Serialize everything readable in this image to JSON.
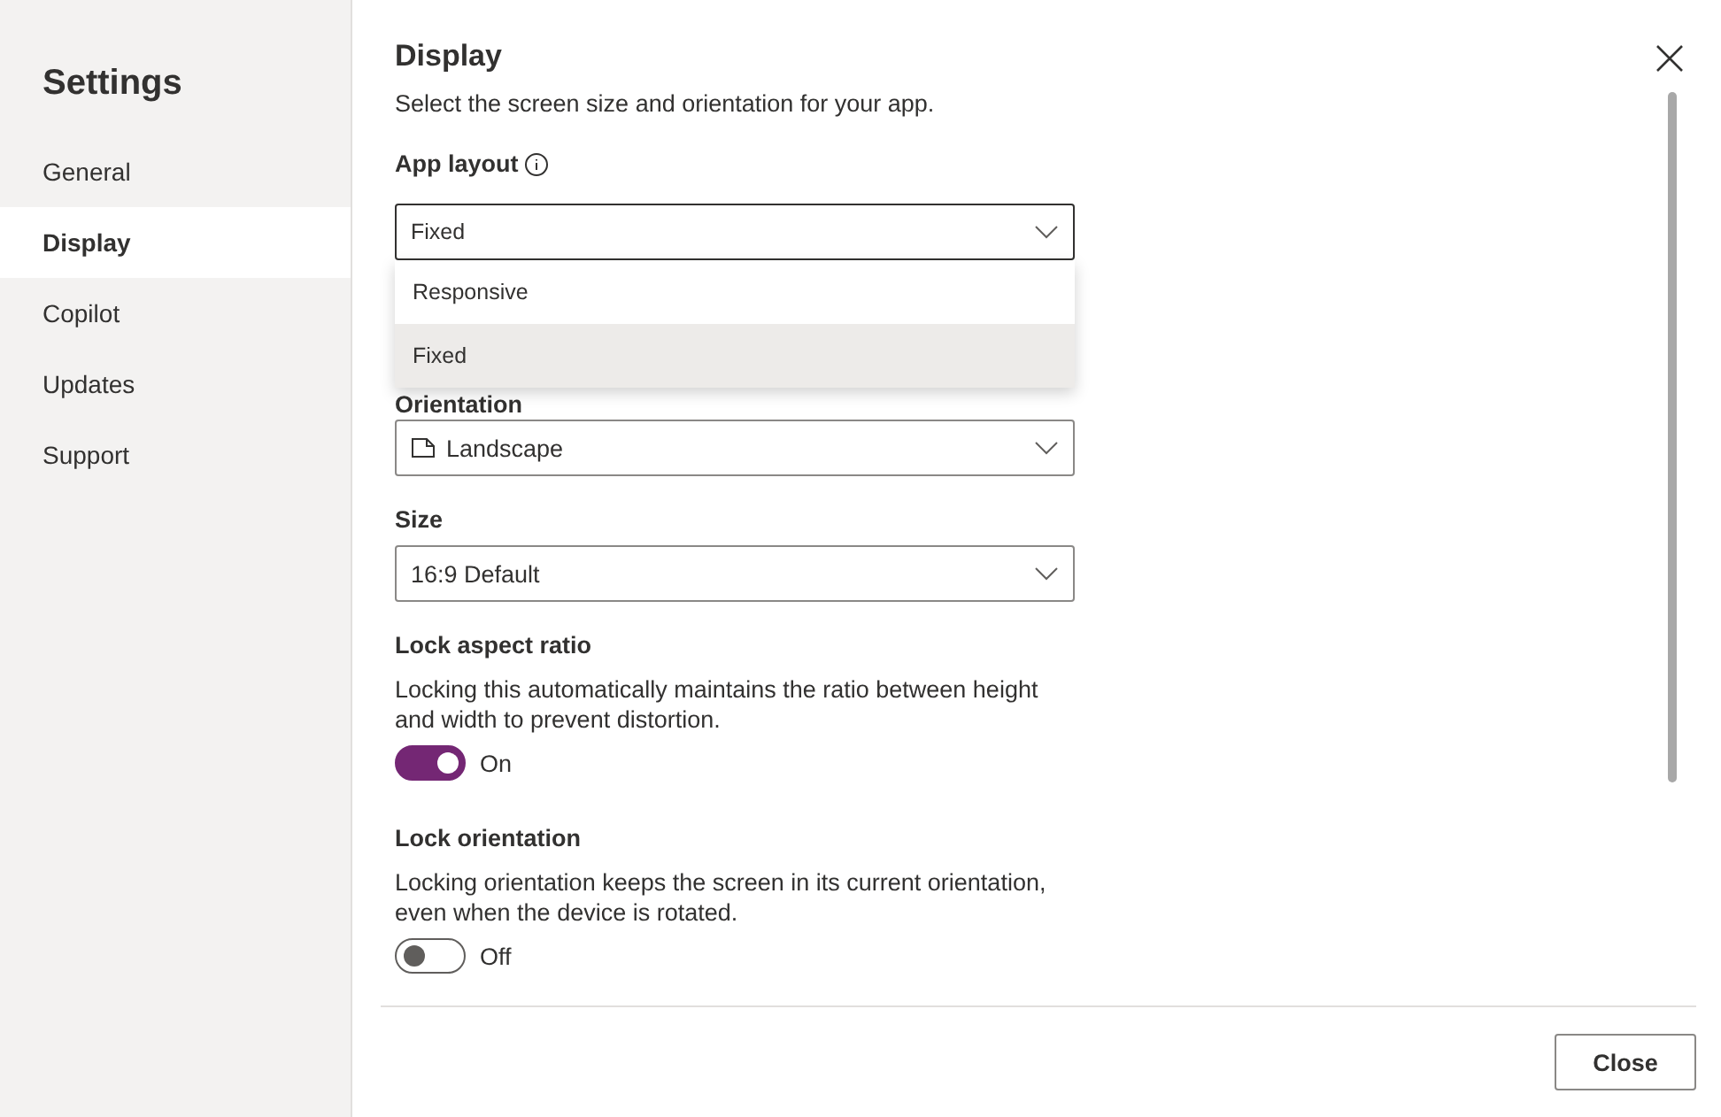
{
  "sidebar": {
    "title": "Settings",
    "items": [
      {
        "label": "General",
        "selected": false
      },
      {
        "label": "Display",
        "selected": true
      },
      {
        "label": "Copilot",
        "selected": false
      },
      {
        "label": "Updates",
        "selected": false
      },
      {
        "label": "Support",
        "selected": false
      }
    ]
  },
  "panel": {
    "title": "Display",
    "description": "Select the screen size and orientation for your app.",
    "app_layout": {
      "label": "App layout",
      "value": "Fixed",
      "expanded": true,
      "options": [
        {
          "label": "Responsive",
          "selected": false
        },
        {
          "label": "Fixed",
          "selected": true
        }
      ]
    },
    "orientation": {
      "label": "Orientation",
      "value": "Landscape"
    },
    "size": {
      "label": "Size",
      "value": "16:9 Default"
    },
    "toggles": [
      {
        "title": "Lock aspect ratio",
        "description": "Locking this automatically maintains the ratio between height and width to prevent distortion.",
        "on": true,
        "state_label": "On"
      },
      {
        "title": "Lock orientation",
        "description": "Locking orientation keeps the screen in its current orientation, even when the device is rotated.",
        "on": false,
        "state_label": "Off"
      }
    ]
  },
  "footer": {
    "button": "Close"
  }
}
